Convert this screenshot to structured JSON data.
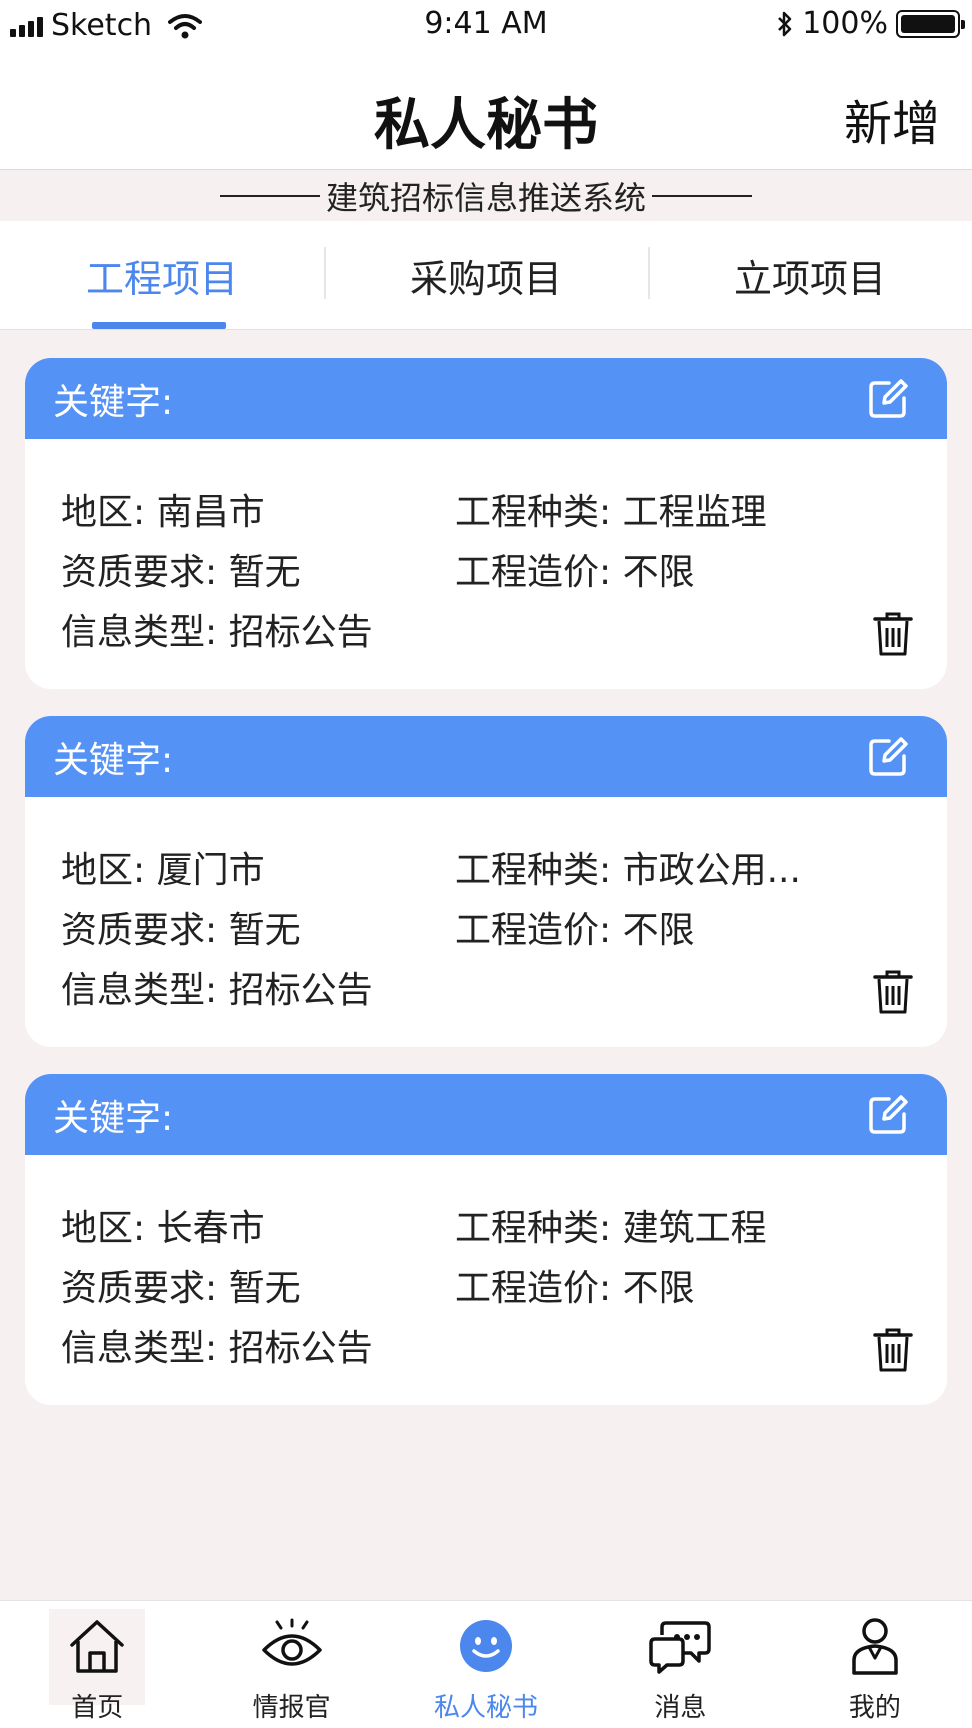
{
  "status_bar": {
    "carrier": "Sketch",
    "time": "9:41 AM",
    "battery": "100%"
  },
  "header": {
    "title": "私人秘书",
    "action": "新增"
  },
  "subtitle": "建筑招标信息推送系统",
  "tabs": [
    {
      "label": "工程项目"
    },
    {
      "label": "采购项目"
    },
    {
      "label": "立项项目"
    }
  ],
  "cards": [
    {
      "keyword_label": "关键字:",
      "region": "地区: 南昌市",
      "project_type": "工程种类: 工程监理",
      "qualification": "资质要求: 暂无",
      "cost": "工程造价: 不限",
      "info_type": "信息类型: 招标公告"
    },
    {
      "keyword_label": "关键字:",
      "region": "地区: 厦门市",
      "project_type": "工程种类: 市政公用...",
      "qualification": "资质要求: 暂无",
      "cost": "工程造价: 不限",
      "info_type": "信息类型: 招标公告"
    },
    {
      "keyword_label": "关键字:",
      "region": "地区: 长春市",
      "project_type": "工程种类: 建筑工程",
      "qualification": "资质要求: 暂无",
      "cost": "工程造价: 不限",
      "info_type": "信息类型: 招标公告"
    }
  ],
  "bottom_nav": [
    {
      "label": "首页",
      "icon": "home-icon"
    },
    {
      "label": "情报官",
      "icon": "eye-icon"
    },
    {
      "label": "私人秘书",
      "icon": "smiley-icon"
    },
    {
      "label": "消息",
      "icon": "chat-icon"
    },
    {
      "label": "我的",
      "icon": "user-icon"
    }
  ],
  "colors": {
    "accent": "#4b87ec",
    "card_header": "#5592f5",
    "background": "#f6f1f0"
  }
}
